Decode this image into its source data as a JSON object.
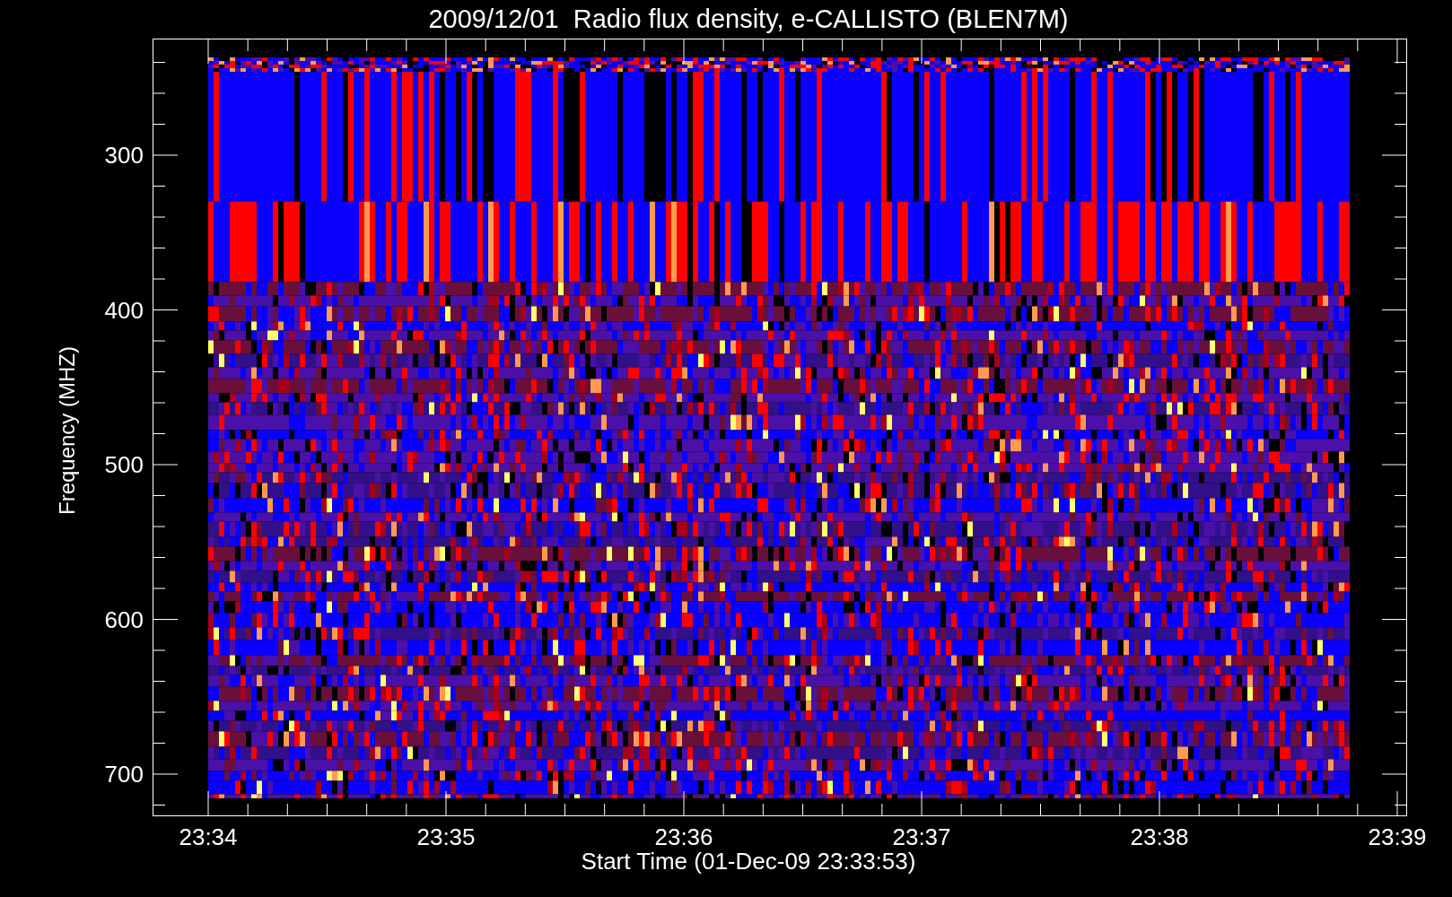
{
  "title": "2009/12/01  Radio flux density, e-CALLISTO (BLEN7M)",
  "y_axis": {
    "label": "Frequency (MHZ)",
    "ticks": [
      "300",
      "400",
      "500",
      "600",
      "700"
    ]
  },
  "x_axis": {
    "label": "Start Time (01-Dec-09 23:33:53)",
    "ticks": [
      "23:34",
      "23:35",
      "23:36",
      "23:37",
      "23:38",
      "23:39"
    ]
  }
}
